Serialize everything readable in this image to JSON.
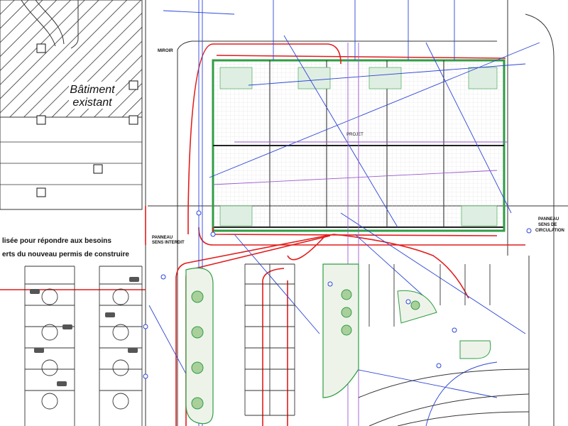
{
  "plan": {
    "existing_building": {
      "line1": "Bâtiment",
      "line2": "existant"
    },
    "project_label": {
      "line1": "PROJET"
    },
    "left_notes": {
      "note1": "lisée pour répondre aux besoins",
      "note2": "erts du nouveau permis de construire"
    },
    "signs": {
      "left_panel": {
        "line1": "PANNEAU",
        "line2": "SENS INTERDIT"
      },
      "right_panel": {
        "line1": "PANNEAU",
        "line2": "SENS DE",
        "line3": "CIRCULATION"
      }
    },
    "miroir": "MIROIR",
    "colors": {
      "red": "#e31b1b",
      "blue": "#2c45d6",
      "purple": "#9a5bd1",
      "green": "#2f9e44",
      "dark": "#222222",
      "hatch": "#444444"
    }
  }
}
